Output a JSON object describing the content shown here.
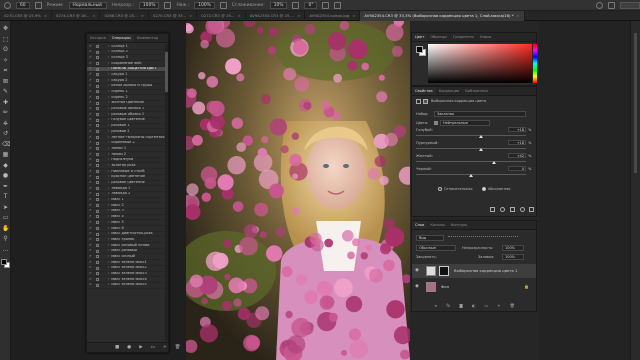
{
  "options_bar": {
    "brush_size": "60",
    "mode_label": "Режим:",
    "mode_value": "Нормальный",
    "opacity_label": "Непрозр.:",
    "opacity_value": "100%",
    "flow_label": "Наж.:",
    "flow_value": "100%",
    "smoothing_label": "Сглаживание:",
    "smoothing_value": "10%",
    "angle_value": "0°"
  },
  "tabs": [
    {
      "label": "0270.CR3 @ 25,9%"
    },
    {
      "label": "0274.CR3 @ 16..."
    },
    {
      "label": "0268.CR3 @ 25..."
    },
    {
      "label": "0270.CR3 @ 33..."
    },
    {
      "label": "0272.CR3 @ 25..."
    },
    {
      "label": "AV9A2354.CR3 @ 25,..."
    },
    {
      "label": "AV9A2354 копия.jpg"
    },
    {
      "label": "AV9A2354.CR3 @ 33,3% (Выборочная коррекция цвета 1, Слой-маска/16) *",
      "active": true
    }
  ],
  "history_panel": {
    "tabs": [
      "История",
      "Операции",
      "Комментар"
    ],
    "active_tab": "Операции",
    "items": [
      "солнце 1",
      "солнце 2",
      "солнце 3",
      "сохранение web",
      "ПАНЕЛЬ ЗАЩЕНОВ ЦВЕТ",
      "сакура 1",
      "сакура 2",
      "белое облако и груша",
      "сирень 1",
      "сирень 2",
      "желтое цветение",
      "розовые облако 1",
      "розовые облако 2",
      "голубое цветение",
      "розовое 1",
      "розовое 2",
      "летние тюльпаны гортензия",
      "сиреневые 2",
      "лилии 1",
      "лилии 2",
      "подсолнухи",
      "золотая роза",
      "пионовые и столб",
      "красное цветение",
      "розовое цветение",
      "лаванда 1",
      "лаванда 2",
      "микс 1",
      "микс 2",
      "микс 3",
      "микс 4",
      "микс 5",
      "микс 6",
      "микс диагностик-роза",
      "микс тропик",
      "микс розовый лилии",
      "микс розовый",
      "микс сочный",
      "микс зелени микс1",
      "микс зелени микс2",
      "микс зелени микс3",
      "микс зелени микс4",
      "микс зелени микс5"
    ],
    "selected_index": 4
  },
  "color_panel": {
    "tabs": [
      "Цвет",
      "Образцы",
      "Градиенты",
      "Узоры"
    ],
    "active_tab": "Цвет"
  },
  "properties_panel": {
    "tabs": [
      "Свойства",
      "Коррекция",
      "Библиотеки"
    ],
    "active_tab": "Свойства",
    "title": "Выборочная коррекция цвета",
    "preset_label": "Набор:",
    "preset_value": "Заказная",
    "colors_label": "Цвета:",
    "colors_value": "Нейтральные",
    "sliders": [
      {
        "label": "Голубой:",
        "value": "+18",
        "unit": "%",
        "level": 0.59
      },
      {
        "label": "Пурпурный:",
        "value": "+18",
        "unit": "%",
        "level": 0.59
      },
      {
        "label": "Желтый:",
        "value": "+42",
        "unit": "%",
        "level": 0.71
      },
      {
        "label": "Черный:",
        "value": "0",
        "unit": "%",
        "level": 0.5
      }
    ],
    "method_relative": "Относительная",
    "method_absolute": "Абсолютная",
    "method_selected": "Абсолютная"
  },
  "layers_panel": {
    "tabs": [
      "Слои",
      "Каналы",
      "Контуры"
    ],
    "active_tab": "Слои",
    "filter_label": "Вид",
    "blend_mode": "Обычные",
    "opacity_label": "Непрозрачность:",
    "opacity_value": "100%",
    "lock_label": "Закрепить:",
    "fill_label": "Заливка:",
    "fill_value": "100%",
    "layers": [
      {
        "name": "Выборочная коррекция цвета 1",
        "selected": true
      },
      {
        "name": "Фон",
        "selected": false
      }
    ]
  },
  "colors": {
    "accent_pink": "#c8568e",
    "panel_bg": "#2b2b2b",
    "app_bg": "#262626"
  }
}
